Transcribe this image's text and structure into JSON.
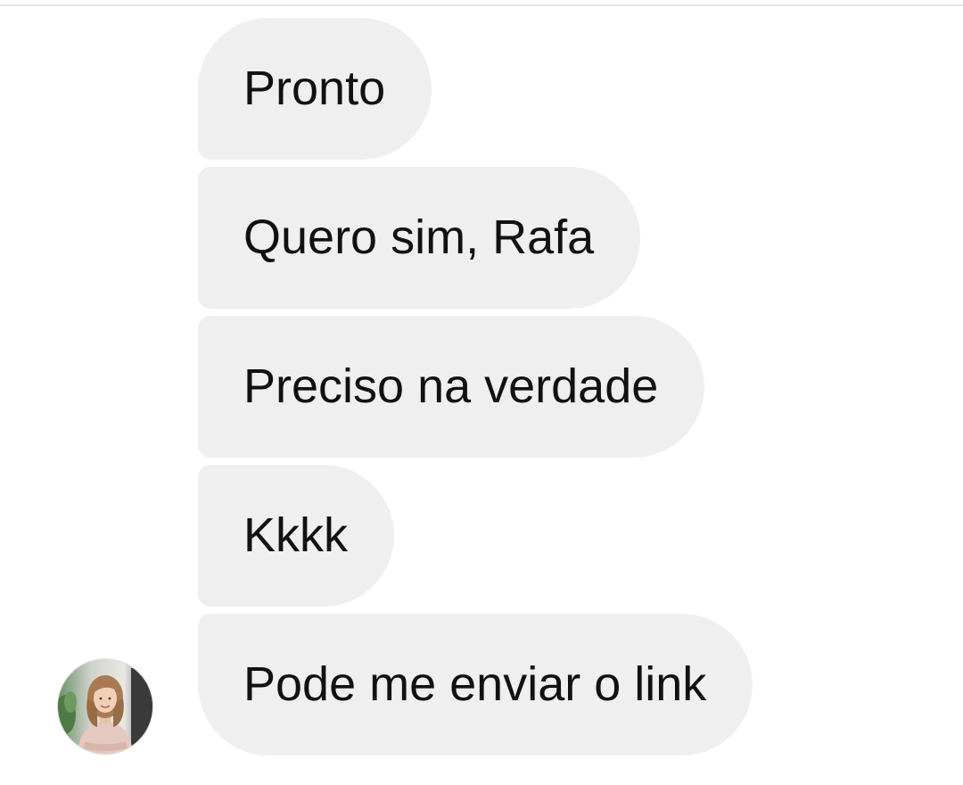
{
  "conversation": {
    "messages": [
      {
        "text": "Pronto"
      },
      {
        "text": "Quero sim, Rafa"
      },
      {
        "text": "Preciso na verdade"
      },
      {
        "text": "Kkkk"
      },
      {
        "text": "Pode me enviar o link"
      }
    ],
    "sender_avatar": {
      "icon": "profile-photo-avatar"
    }
  },
  "colors": {
    "background": "#ffffff",
    "bubble": "#efefef",
    "text": "#111111"
  }
}
